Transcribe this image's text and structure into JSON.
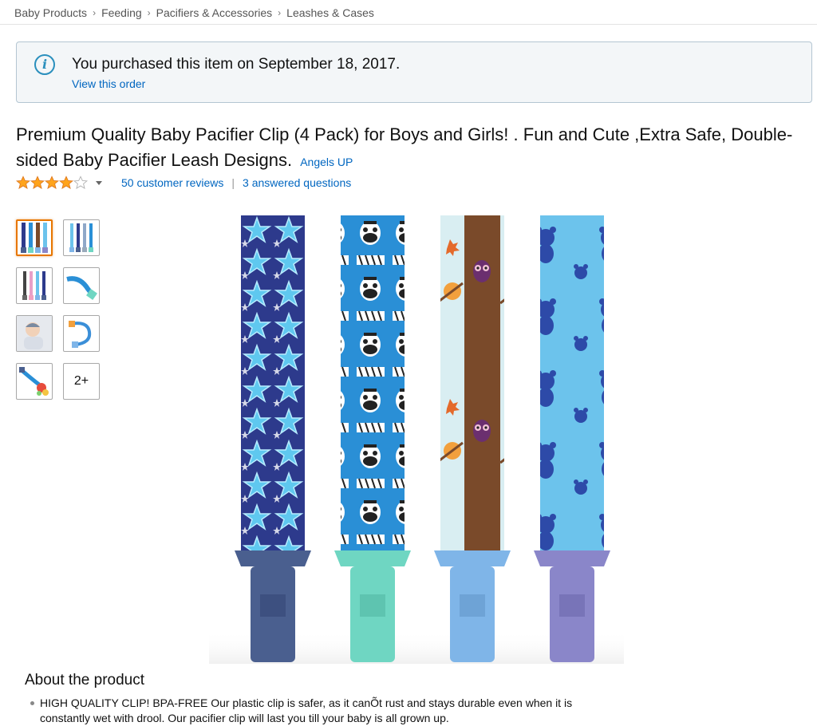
{
  "breadcrumb": {
    "items": [
      "Baby Products",
      "Feeding",
      "Pacifiers & Accessories",
      "Leashes & Cases"
    ],
    "separator": "›"
  },
  "notice": {
    "icon": "info-icon",
    "message": "You purchased this item on September 18, 2017.",
    "link": "View this order"
  },
  "product": {
    "title": "Premium Quality Baby Pacifier Clip (4 Pack) for Boys and Girls! . Fun and Cute ,Extra Safe, Double-sided Baby Pacifier Leash Designs.",
    "brand": "Angels UP",
    "rating_stars": 4,
    "rating_max": 5,
    "reviews": "50 customer reviews",
    "separator": "|",
    "questions": "3 answered questions"
  },
  "gallery": {
    "more_label": "2+",
    "thumbnails": [
      "thumb-four-clips",
      "thumb-blue-clips",
      "thumb-mixed-clips",
      "thumb-clip-closeup",
      "thumb-baby-photo",
      "thumb-clip-curled",
      "thumb-clip-with-toy"
    ],
    "main_image": "four-pacifier-clips"
  },
  "about": {
    "heading": "About the product",
    "bullets": [
      "HIGH QUALITY CLIP! BPA-FREE Our plastic clip is safer, as it canÕt rust and stays durable even when it is constantly wet with drool. Our pacifier clip will last you till your baby is all grown up."
    ]
  },
  "colors": {
    "link": "#0066c0",
    "star": "#ffa41c",
    "selected_thumb": "#e77600",
    "notice_bg": "#f3f6f8",
    "strap_navy": "#2d3a8c",
    "strap_blue": "#2a8fd6",
    "strap_brown": "#7a4a2a",
    "strap_lightblue": "#6cc3ec",
    "clip_navy": "#4a5f8f",
    "clip_mint": "#6fd6c2",
    "clip_blue": "#7fb5e8",
    "clip_purple": "#8a86c9"
  }
}
